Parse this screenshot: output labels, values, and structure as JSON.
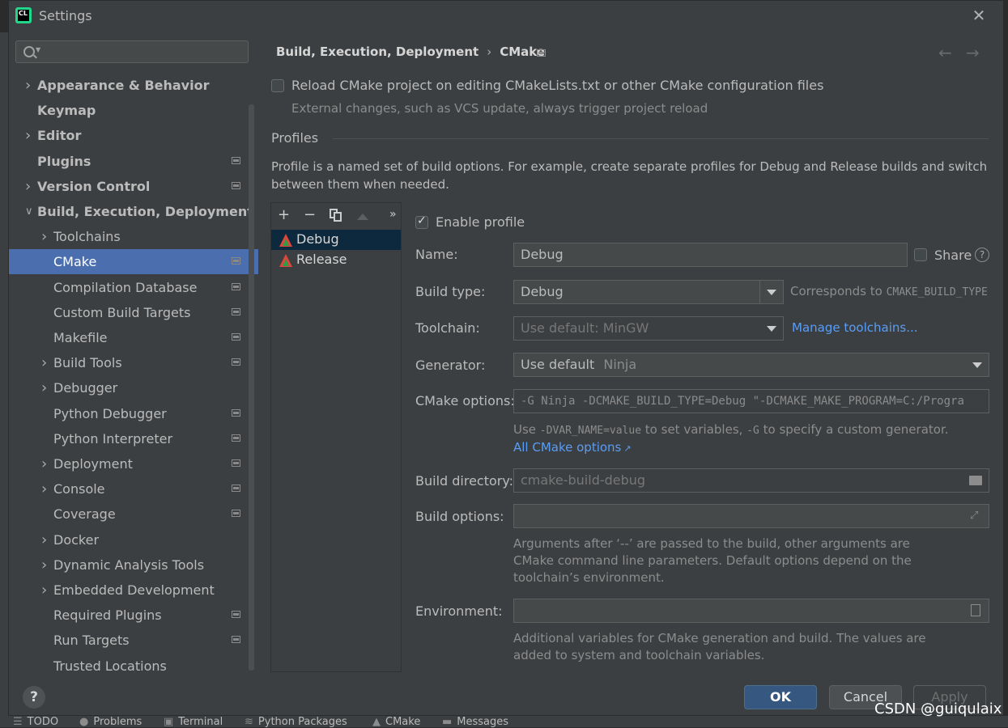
{
  "window": {
    "title": "Settings",
    "close_glyph": "✕",
    "app_logo_text": "CL"
  },
  "sidebar": {
    "search_placeholder": "",
    "items": [
      {
        "label": "Appearance & Behavior",
        "bold": true,
        "expandable": true,
        "expanded": false
      },
      {
        "label": "Keymap",
        "bold": true,
        "expandable": false
      },
      {
        "label": "Editor",
        "bold": true,
        "expandable": true,
        "expanded": false
      },
      {
        "label": "Plugins",
        "bold": true,
        "expandable": false,
        "project_icon": true
      },
      {
        "label": "Version Control",
        "bold": true,
        "expandable": true,
        "expanded": false,
        "project_icon": true
      },
      {
        "label": "Build, Execution, Deployment",
        "bold": true,
        "expandable": true,
        "expanded": true
      },
      {
        "label": "Toolchains",
        "expandable": true,
        "expanded": false
      },
      {
        "label": "CMake",
        "selected": true,
        "project_icon": true
      },
      {
        "label": "Compilation Database",
        "project_icon": true
      },
      {
        "label": "Custom Build Targets",
        "project_icon": true
      },
      {
        "label": "Makefile",
        "project_icon": true
      },
      {
        "label": "Build Tools",
        "expandable": true,
        "expanded": false,
        "project_icon": true
      },
      {
        "label": "Debugger",
        "expandable": true,
        "expanded": false
      },
      {
        "label": "Python Debugger",
        "project_icon": true
      },
      {
        "label": "Python Interpreter",
        "project_icon": true
      },
      {
        "label": "Deployment",
        "expandable": true,
        "expanded": false,
        "project_icon": true
      },
      {
        "label": "Console",
        "expandable": true,
        "expanded": false,
        "project_icon": true
      },
      {
        "label": "Coverage",
        "project_icon": true
      },
      {
        "label": "Docker",
        "expandable": true,
        "expanded": false
      },
      {
        "label": "Dynamic Analysis Tools",
        "expandable": true,
        "expanded": false
      },
      {
        "label": "Embedded Development",
        "expandable": true,
        "expanded": false
      },
      {
        "label": "Required Plugins",
        "project_icon": true
      },
      {
        "label": "Run Targets",
        "project_icon": true
      },
      {
        "label": "Trusted Locations"
      }
    ]
  },
  "breadcrumb": {
    "parent": "Build, Execution, Deployment",
    "separator": "›",
    "current": "CMake",
    "back_glyph": "←",
    "forward_glyph": "→"
  },
  "reload": {
    "label": "Reload CMake project on editing CMakeLists.txt or other CMake configuration files",
    "hint": "External changes, such as VCS update, always trigger project reload",
    "checked": false
  },
  "profiles": {
    "section_title": "Profiles",
    "description_line1": "Profile is a named set of build options. For example, create separate profiles for Debug and Release builds and switch",
    "description_line2": "between them when needed.",
    "toolbar": {
      "add": "+",
      "remove": "−",
      "more": "»"
    },
    "list": [
      {
        "name": "Debug",
        "selected": true
      },
      {
        "name": "Release",
        "selected": false
      }
    ]
  },
  "form": {
    "enable_profile": {
      "label": "Enable profile",
      "checked": true
    },
    "name": {
      "label": "Name:",
      "value": "Debug"
    },
    "share": {
      "label": "Share",
      "checked": false,
      "help_glyph": "?"
    },
    "build_type": {
      "label": "Build type:",
      "value": "Debug",
      "note_prefix": "Corresponds to ",
      "note_code": "CMAKE_BUILD_TYPE"
    },
    "toolchain": {
      "label": "Toolchain:",
      "value": "Use default: MinGW",
      "link": "Manage toolchains..."
    },
    "generator": {
      "label": "Generator:",
      "value": "Use default",
      "value_hint": "Ninja"
    },
    "cmake_options": {
      "label": "CMake options:",
      "value": "-G Ninja -DCMAKE_BUILD_TYPE=Debug \"-DCMAKE_MAKE_PROGRAM=C:/Progra",
      "hint_1": "Use ",
      "hint_code_1": "-DVAR_NAME=value",
      "hint_2": " to set variables, ",
      "hint_code_2": "-G",
      "hint_3": " to specify a custom generator.",
      "link": "All CMake options",
      "link_arrow": "↗"
    },
    "build_directory": {
      "label": "Build directory:",
      "value": "cmake-build-debug"
    },
    "build_options": {
      "label": "Build options:",
      "value": "",
      "hint_line1": "Arguments after ‘--’ are passed to the build, other arguments are",
      "hint_line2": "CMake command line parameters. Default options depend on the",
      "hint_line3": "toolchain’s environment."
    },
    "environment": {
      "label": "Environment:",
      "value": "",
      "hint_line1": "Additional variables for CMake generation and build. The values are",
      "hint_line2": "added to system and toolchain variables."
    }
  },
  "footer": {
    "help": "?",
    "ok": "OK",
    "cancel": "Cancel",
    "apply": "Apply"
  },
  "background": {
    "bottom_tabs": [
      "TODO",
      "Problems",
      "Terminal",
      "Python Packages",
      "CMake",
      "Messages"
    ]
  },
  "watermark": "CSDN @guiqulaix",
  "colors": {
    "selection": "#4b6eaf",
    "ok_button": "#365880",
    "link": "#589df6",
    "panel": "#3c3f41"
  }
}
